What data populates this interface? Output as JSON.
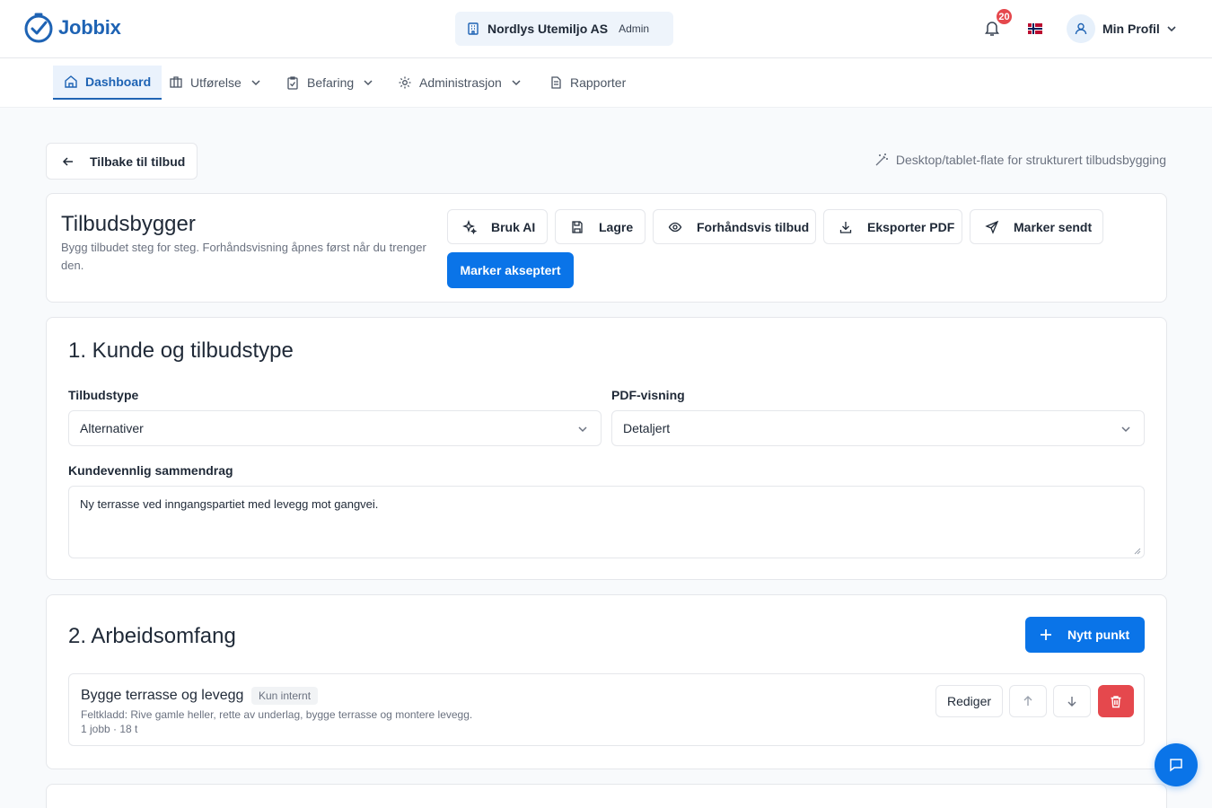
{
  "app": {
    "name": "Jobbix"
  },
  "header": {
    "company": "Nordlys Utemiljo AS",
    "role": "Admin",
    "notification_count": "20",
    "profile_label": "Min Profil"
  },
  "nav": {
    "items": [
      {
        "label": "Dashboard",
        "active": true
      },
      {
        "label": "Utførelse"
      },
      {
        "label": "Befaring"
      },
      {
        "label": "Administrasjon"
      },
      {
        "label": "Rapporter"
      }
    ]
  },
  "page": {
    "back_label": "Tilbake til tilbud",
    "hint": "Desktop/tablet-flate for strukturert tilbudsbygging"
  },
  "builder": {
    "title": "Tilbudsbygger",
    "subtitle": "Bygg tilbudet steg for steg. Forhåndsvisning åpnes først når du trenger den.",
    "actions": {
      "ai": "Bruk AI",
      "save": "Lagre",
      "preview": "Forhåndsvis tilbud",
      "export": "Eksporter PDF",
      "mark_sent": "Marker sendt",
      "mark_accepted": "Marker akseptert"
    }
  },
  "section1": {
    "title": "1. Kunde og tilbudstype",
    "offer_type_label": "Tilbudstype",
    "offer_type_value": "Alternativer",
    "pdf_view_label": "PDF-visning",
    "pdf_view_value": "Detaljert",
    "summary_label": "Kundevennlig sammendrag",
    "summary_value": "Ny terrasse ved inngangspartiet med levegg mot gangvei."
  },
  "section2": {
    "title": "2. Arbeidsomfang",
    "new_item_label": "Nytt punkt",
    "items": [
      {
        "title": "Bygge terrasse og levegg",
        "tag": "Kun internt",
        "description": "Feltkladd: Rive gamle heller, rette av underlag, bygge terrasse og montere levegg.",
        "meta": "1 jobb · 18 t",
        "edit_label": "Rediger"
      }
    ]
  },
  "colors": {
    "primary": "#0a74e8",
    "brand": "#1e63b4",
    "danger": "#e5484d"
  },
  "icons": {
    "logo": "clock-check-icon",
    "company": "building-icon",
    "bell": "bell-icon",
    "flag": "norway-flag-icon",
    "profile": "user-icon",
    "chat": "chat-icon"
  }
}
